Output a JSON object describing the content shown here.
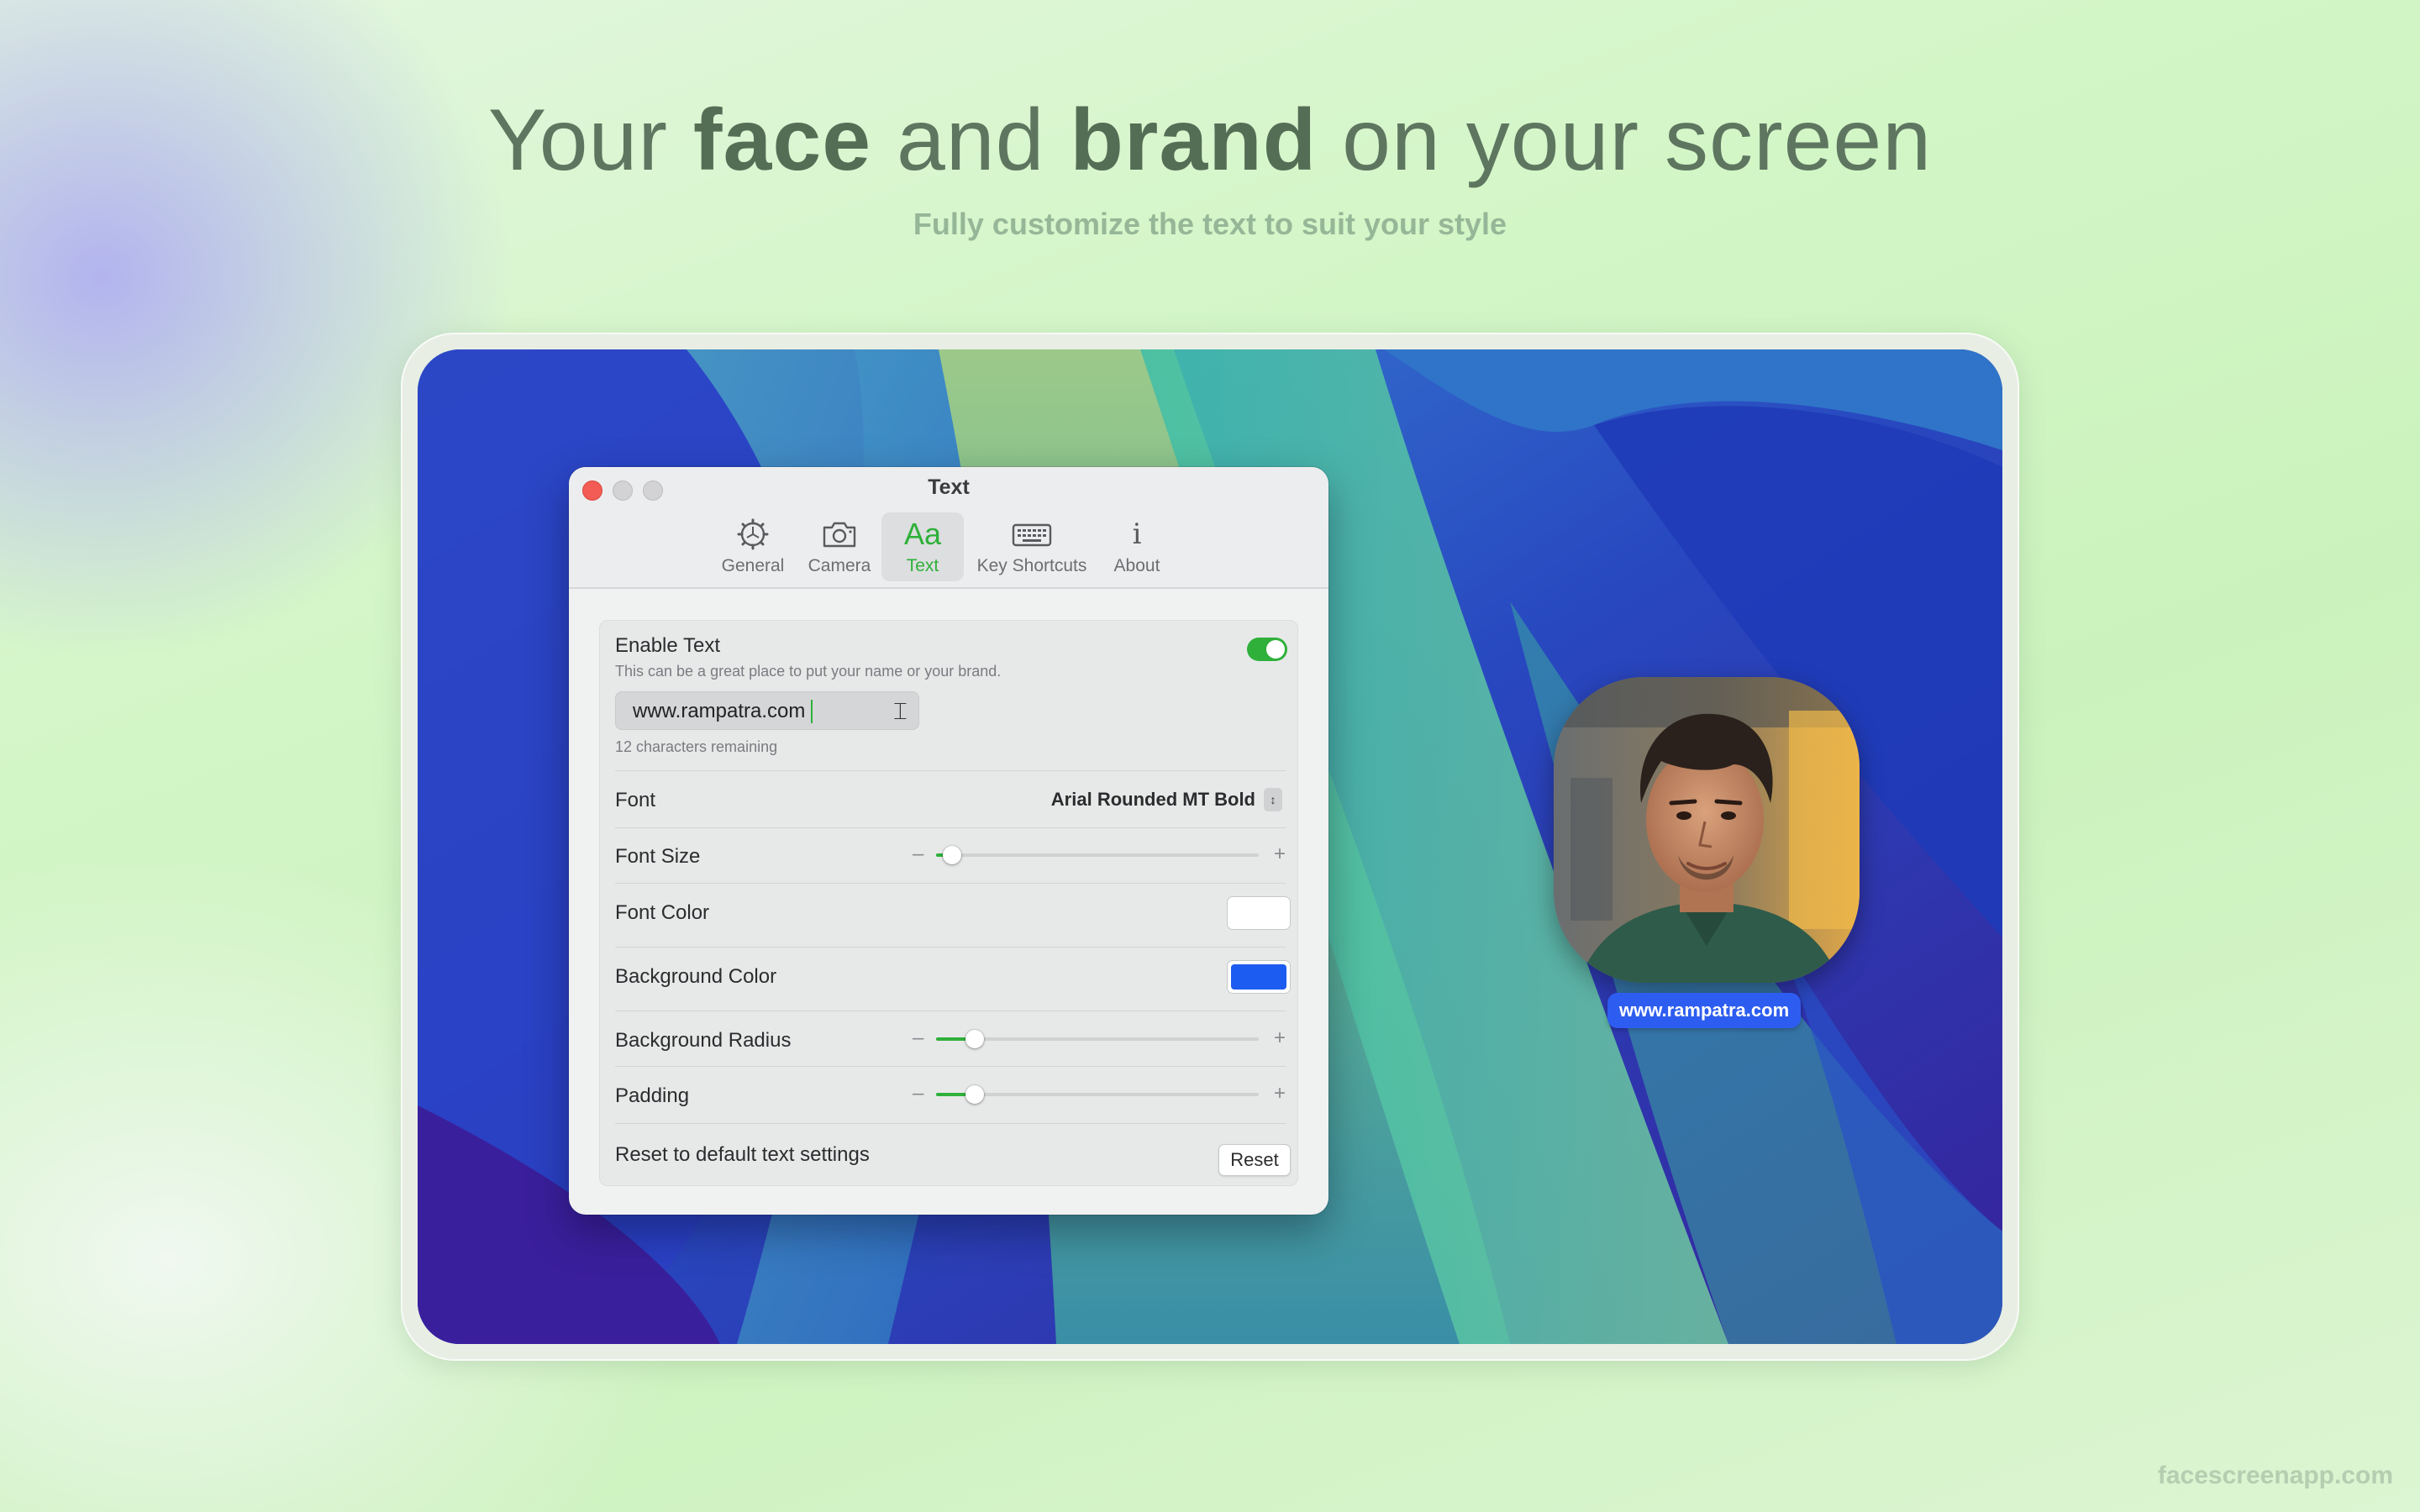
{
  "hero": {
    "line_prefix": "Your ",
    "line_bold1": "face",
    "line_mid": " and ",
    "line_bold2": "brand",
    "line_suffix": " on your screen",
    "subtitle": "Fully customize the text to suit your style"
  },
  "footer": {
    "brand": "facescreenapp.com"
  },
  "window": {
    "title": "Text",
    "tabs": [
      {
        "label": "General",
        "icon": "gear-icon"
      },
      {
        "label": "Camera",
        "icon": "camera-icon"
      },
      {
        "label": "Text",
        "icon": "text-aa-icon",
        "glyph": "Aa",
        "active": true
      },
      {
        "label": "Key Shortcuts",
        "icon": "keyboard-icon"
      },
      {
        "label": "About",
        "icon": "info-icon",
        "glyph": "i"
      }
    ]
  },
  "settings": {
    "enable_text": {
      "label": "Enable Text",
      "hint": "This can be a great place to put your name or your brand.",
      "enabled": true
    },
    "text_value": "www.rampatra.com",
    "chars_remaining": "12 characters remaining",
    "font": {
      "label": "Font",
      "value": "Arial Rounded MT Bold"
    },
    "font_size": {
      "label": "Font Size",
      "level": 0.05,
      "minus": "–",
      "plus": "+"
    },
    "font_color": {
      "label": "Font Color",
      "color": "#ffffff"
    },
    "background_color": {
      "label": "Background Color",
      "color": "#1d5cf0"
    },
    "background_radius": {
      "label": "Background Radius",
      "level": 0.12,
      "minus": "–",
      "plus": "+"
    },
    "padding": {
      "label": "Padding",
      "level": 0.12,
      "minus": "–",
      "plus": "+"
    },
    "reset": {
      "label": "Reset to default text settings",
      "button": "Reset"
    }
  },
  "preview": {
    "badge_text": "www.rampatra.com",
    "badge_color": "#2d5df0"
  },
  "colors": {
    "accent": "#2fb03a"
  }
}
